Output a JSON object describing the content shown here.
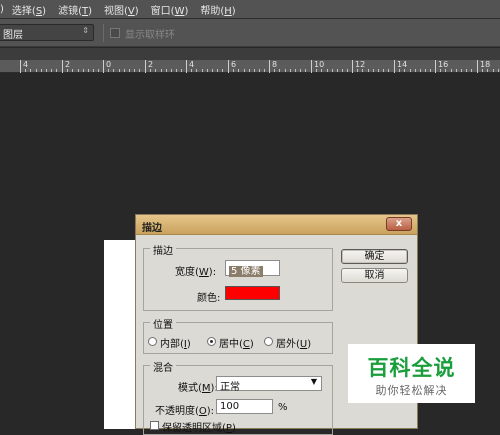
{
  "menubar": {
    "items": [
      {
        "pre": ")",
        "accel": "",
        "post": ""
      },
      {
        "pre": "选择(",
        "accel": "S",
        "post": ")"
      },
      {
        "pre": "滤镜(",
        "accel": "T",
        "post": ")"
      },
      {
        "pre": "视图(",
        "accel": "V",
        "post": ")"
      },
      {
        "pre": "窗口(",
        "accel": "W",
        "post": ")"
      },
      {
        "pre": "帮助(",
        "accel": "H",
        "post": ")"
      }
    ]
  },
  "options": {
    "layer_select": "图层",
    "sample_ring_label": "显示取样环"
  },
  "ruler": {
    "labels": [
      "4",
      "2",
      "0",
      "2",
      "4",
      "6",
      "8",
      "10",
      "12",
      "14",
      "16",
      "18"
    ]
  },
  "dialog": {
    "title": "描边",
    "close": "x",
    "stroke_group": {
      "legend": "描边",
      "width_label_pre": "宽度(",
      "width_accel": "W",
      "width_label_post": "):",
      "width_value": "5 像素",
      "color_label": "颜色:",
      "color": "#ff0000"
    },
    "position_group": {
      "legend": "位置",
      "options": [
        {
          "pre": "内部(",
          "accel": "I",
          "post": ")",
          "selected": false
        },
        {
          "pre": "居中(",
          "accel": "C",
          "post": ")",
          "selected": true
        },
        {
          "pre": "居外(",
          "accel": "U",
          "post": ")",
          "selected": false
        }
      ]
    },
    "blend_group": {
      "legend": "混合",
      "mode_label_pre": "模式(",
      "mode_accel": "M",
      "mode_label_post": "):",
      "mode_value": "正常",
      "opacity_label_pre": "不透明度(",
      "opacity_accel": "O",
      "opacity_label_post": "):",
      "opacity_value": "100",
      "opacity_unit": "%",
      "preserve_label_pre": "保留透明区域(",
      "preserve_accel": "P",
      "preserve_label_post": ")"
    },
    "ok_button": "确定",
    "cancel_button": "取消"
  },
  "watermark": {
    "title": "百科全说",
    "subtitle": "助你轻松解决"
  }
}
